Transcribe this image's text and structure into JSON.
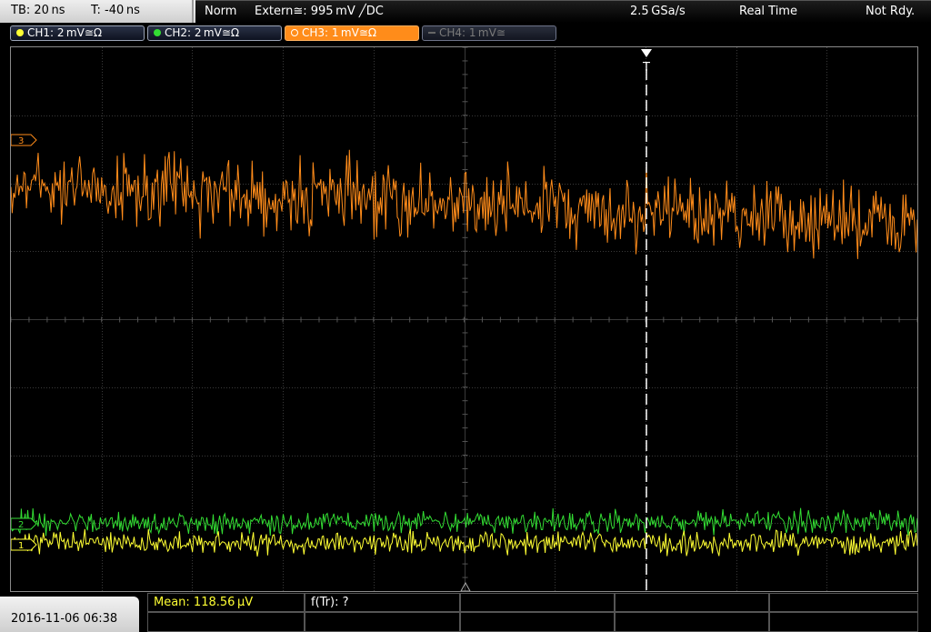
{
  "status_bar": {
    "timebase": "TB: 20 ns",
    "trigger_pos": "T: -40 ns",
    "trigger_mode": "Norm",
    "trigger_source": "Extern≅: 995 mV ╱DC",
    "sample_rate": "2.5 GSa/s",
    "acq_mode": "Real Time",
    "state": "Not Rdy."
  },
  "channels": [
    {
      "label": "CH1: 2 mV≅Ω",
      "color": "#ffff33",
      "state": "on"
    },
    {
      "label": "CH2: 2 mV≅Ω",
      "color": "#33dd33",
      "state": "on"
    },
    {
      "label": "CH3: 1 mV≅Ω",
      "color": "#ff8c1a",
      "state": "active"
    },
    {
      "label": "CH4: 1 mV≅",
      "color": "#666666",
      "state": "off"
    }
  ],
  "trigger_marker": "T",
  "waveform_labels": {
    "ch3": "3",
    "ch2": "2",
    "ch1": "1"
  },
  "waveform_colors": {
    "ch1": "#ffff33",
    "ch2": "#33dd33",
    "ch3": "#ff8c1a"
  },
  "measurements": {
    "mean": "Mean: 118.56 µV",
    "freq": "f(Tr): ?"
  },
  "datetime": "2016-11-06 06:38"
}
